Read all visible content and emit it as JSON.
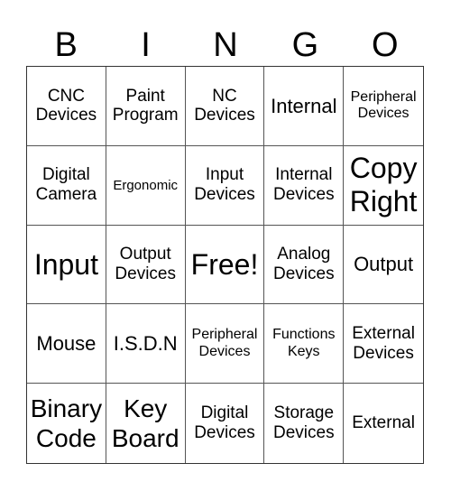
{
  "header": {
    "letters": [
      "B",
      "I",
      "N",
      "G",
      "O"
    ]
  },
  "grid": {
    "cells": [
      {
        "text": "CNC\nDevices",
        "size": "md"
      },
      {
        "text": "Paint\nProgram",
        "size": "md"
      },
      {
        "text": "NC\nDevices",
        "size": "md"
      },
      {
        "text": "Internal",
        "size": "lg"
      },
      {
        "text": "Peripheral\nDevices",
        "size": "sm"
      },
      {
        "text": "Digital\nCamera",
        "size": "md"
      },
      {
        "text": "Ergonomic",
        "size": "xs"
      },
      {
        "text": "Input\nDevices",
        "size": "md"
      },
      {
        "text": "Internal\nDevices",
        "size": "md"
      },
      {
        "text": "Copy\nRight",
        "size": "xxl"
      },
      {
        "text": "Input",
        "size": "xxl"
      },
      {
        "text": "Output\nDevices",
        "size": "md"
      },
      {
        "text": "Free!",
        "size": "xxl"
      },
      {
        "text": "Analog\nDevices",
        "size": "md"
      },
      {
        "text": "Output",
        "size": "lg"
      },
      {
        "text": "Mouse",
        "size": "lg"
      },
      {
        "text": "I.S.D.N",
        "size": "lg"
      },
      {
        "text": "Peripheral\nDevices",
        "size": "sm"
      },
      {
        "text": "Functions\nKeys",
        "size": "sm"
      },
      {
        "text": "External\nDevices",
        "size": "md"
      },
      {
        "text": "Binary\nCode",
        "size": "xl"
      },
      {
        "text": "Key\nBoard",
        "size": "xl"
      },
      {
        "text": "Digital\nDevices",
        "size": "md"
      },
      {
        "text": "Storage\nDevices",
        "size": "md"
      },
      {
        "text": "External",
        "size": "md"
      }
    ]
  }
}
